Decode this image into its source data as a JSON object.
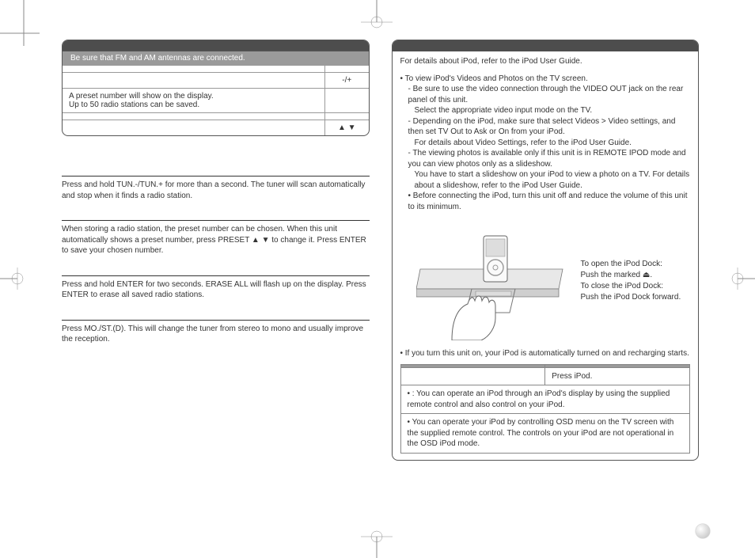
{
  "left": {
    "panel_sub": "Be sure that FM and AM antennas are connected.",
    "row2_right": "-/+",
    "row3_left": "A preset number will show on the display.\nUp to 50 radio stations can be saved.",
    "row5_right": "▲ ▼",
    "sec1": "Press and hold TUN.-/TUN.+ for more than a second. The tuner will scan automatically and stop when it finds a radio station.",
    "sec2": "When storing a radio station, the preset number can be chosen. When this unit automatically shows a preset number, press PRESET ▲ ▼ to change it. Press ENTER to save your chosen number.",
    "sec3": "Press and hold ENTER for two seconds. ERASE ALL will flash up on the display. Press ENTER to erase all saved radio stations.",
    "sec4": "Press MO./ST.(D). This will change the tuner from stereo to mono and usually improve the reception."
  },
  "right": {
    "intro": "For details about iPod, refer to the iPod User Guide.",
    "b1": "• To view iPod's Videos and Photos on the TV screen.",
    "b1a": "- Be sure to use the video connection through the VIDEO OUT jack on the rear panel of this unit.",
    "b1a2": "Select the appropriate video input mode on the TV.",
    "b1b": "- Depending on the iPod, make sure that select Videos > Video settings, and then set TV Out to Ask or On from your iPod.",
    "b1b2": "For details about Video Settings, refer to the iPod User Guide.",
    "b1c": "- The viewing photos is available only if this unit is in REMOTE IPOD mode and you can view photos only as a slideshow.",
    "b1c2": "You have to start a slideshow on your iPod to view a photo on a TV. For details about a slideshow, refer to the iPod User Guide.",
    "b2": "• Before connecting the iPod, turn this unit off and reduce the volume of this unit to its minimum.",
    "dock_open_label": "To open the iPod Dock:",
    "dock_open_action": "Push the marked ⏏.",
    "dock_close_label": "To close the iPod Dock:",
    "dock_close_action": "Push the iPod Dock forward.",
    "recharge": "• If you turn this unit on, your iPod is automatically turned on and recharging starts.",
    "mode_press": "Press iPod.",
    "mode_remote": "•                                : You can operate an iPod through an iPod's display by using the supplied remote control and also control on your iPod.",
    "mode_osd": "•                              You can operate your iPod by controlling OSD menu on the TV screen with the supplied remote control. The controls on your iPod are not operational in the OSD iPod mode."
  }
}
